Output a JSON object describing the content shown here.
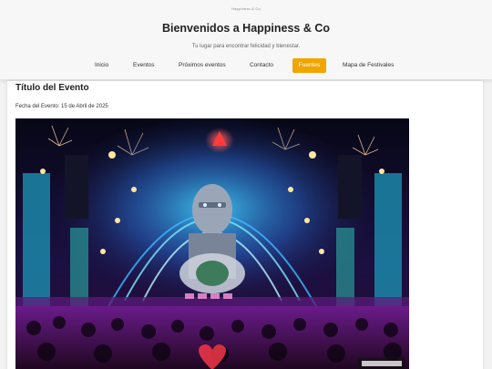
{
  "header": {
    "logo_text": "Happiness & Co",
    "title": "Bienvenidos a Happiness & Co",
    "tagline": "Tu lugar para encontrar felicidad y bienestar."
  },
  "nav": {
    "items": [
      {
        "label": "Inicio"
      },
      {
        "label": "Eventos"
      },
      {
        "label": "Próximos eventos"
      },
      {
        "label": "Contacto"
      },
      {
        "label": "Fuentes"
      },
      {
        "label": "Mapa de Festivales"
      }
    ],
    "active_index": 4,
    "active_color": "#f0a500"
  },
  "event": {
    "title": "Título del Evento",
    "date": "Fecha del Evento: 15 de Abril de 2025",
    "image_icon": "festival-stage-photo"
  }
}
